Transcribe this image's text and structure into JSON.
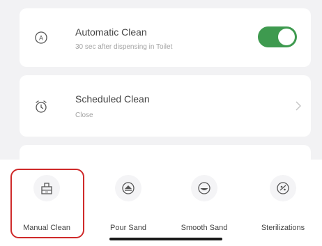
{
  "settings": {
    "automatic_clean": {
      "title": "Automatic Clean",
      "subtitle": "30 sec after dispensing in Toilet",
      "icon": "auto-clean-icon",
      "toggle_on": true
    },
    "scheduled_clean": {
      "title": "Scheduled Clean",
      "subtitle": "Close",
      "icon": "alarm-clock-icon"
    }
  },
  "actions": [
    {
      "label": "Manual Clean",
      "icon": "manual-clean-icon",
      "selected": true
    },
    {
      "label": "Pour Sand",
      "icon": "pour-sand-icon",
      "selected": false
    },
    {
      "label": "Smooth Sand",
      "icon": "smooth-sand-icon",
      "selected": false
    },
    {
      "label": "Sterilizations",
      "icon": "sterilization-icon",
      "selected": false
    }
  ],
  "colors": {
    "toggle_on": "#3e9a4f",
    "selection_outline": "#cf2a2a",
    "background": "#f2f2f4"
  }
}
